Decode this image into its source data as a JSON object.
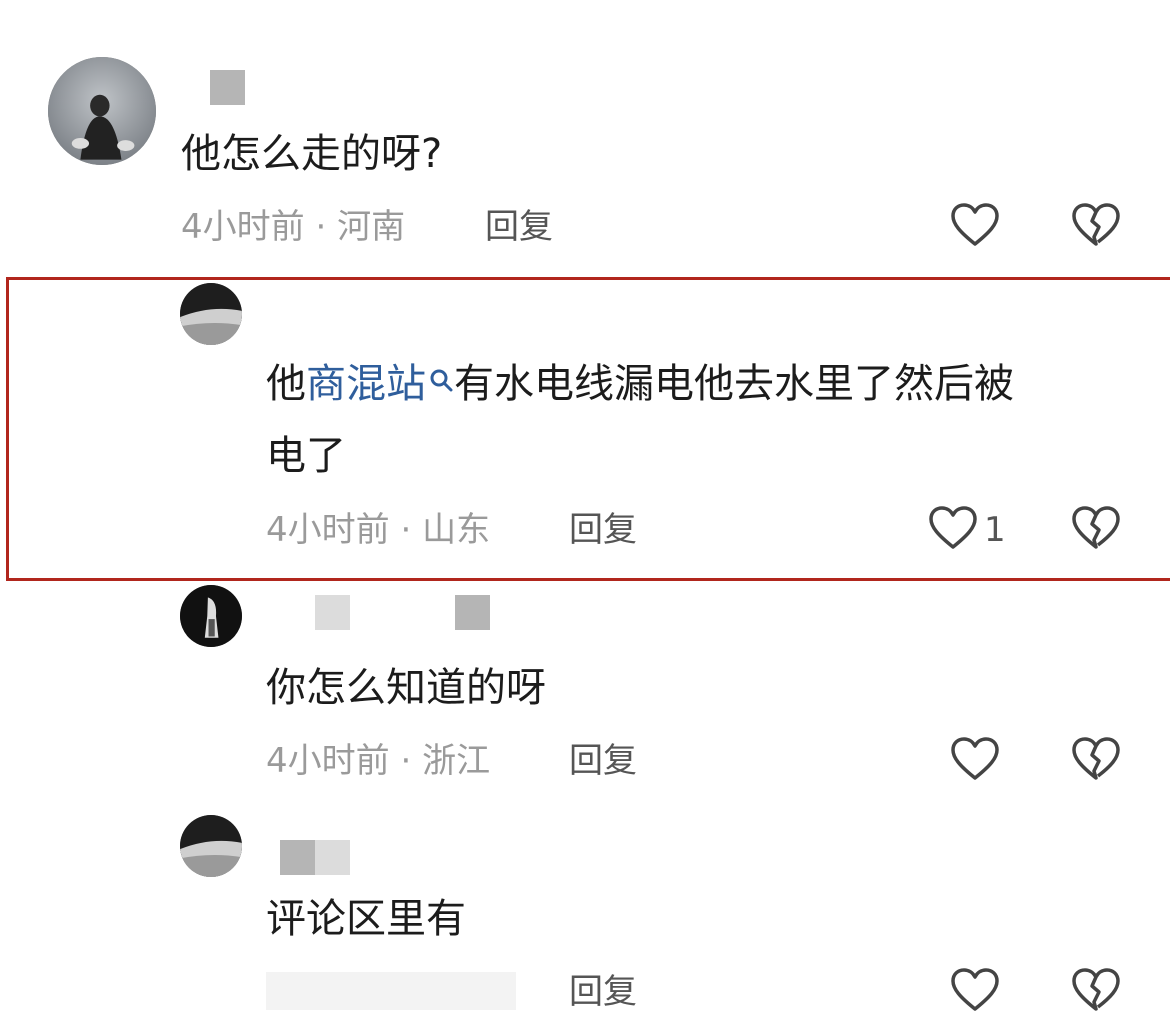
{
  "comments": [
    {
      "text": "他怎么走的呀?",
      "time": "4小时前",
      "region": "河南",
      "reply_label": "回复",
      "like_count": ""
    },
    {
      "text_prefix": "他",
      "link_text": "商混站",
      "text_suffix": "有水电线漏电他去水里了然后被",
      "text_line2": "电了",
      "time": "4小时前",
      "region": "山东",
      "reply_label": "回复",
      "like_count": "1",
      "highlighted": true
    },
    {
      "text": "你怎么知道的呀",
      "time": "4小时前",
      "region": "浙江",
      "reply_label": "回复",
      "like_count": ""
    },
    {
      "text": "评论区里有",
      "reply_label": "回复",
      "like_count": ""
    }
  ],
  "meta_separator": " · ",
  "colors": {
    "highlight_border": "#b1261d",
    "link": "#2f5e9c",
    "meta": "#9a9a9a"
  },
  "icons": [
    "heart-outline-icon",
    "broken-heart-icon",
    "search-icon"
  ]
}
